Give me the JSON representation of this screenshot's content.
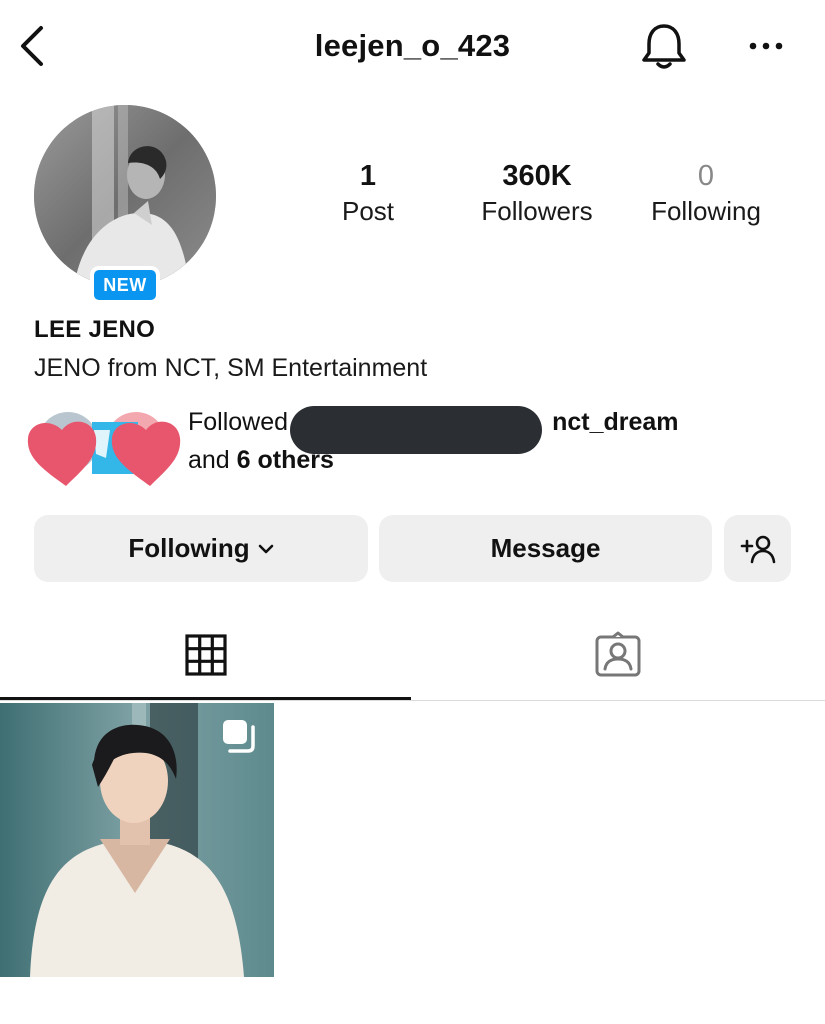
{
  "header": {
    "username": "leejen_o_423",
    "icons": {
      "back": "chevron-left-icon",
      "notifications": "bell-icon",
      "more": "more-horizontal-icon"
    }
  },
  "profile": {
    "avatar_icon": "profile-photo",
    "badge": "NEW",
    "display_name": "LEE JENO",
    "bio": "JENO from NCT, SM Entertainment"
  },
  "stats": {
    "posts": {
      "value": "1",
      "label": "Post"
    },
    "followers": {
      "value": "360K",
      "label": "Followers"
    },
    "following": {
      "value": "0",
      "label": "Following"
    }
  },
  "followed_by": {
    "prefix": "Followed",
    "account": "nct_dream",
    "and_text": "and",
    "others": "6 others"
  },
  "actions": {
    "following_label": "Following",
    "message_label": "Message",
    "add_user_icon": "add-user-icon"
  },
  "tabs": [
    {
      "id": "grid",
      "icon": "grid-icon",
      "active": true
    },
    {
      "id": "tagged",
      "icon": "tagged-user-icon",
      "active": false
    }
  ],
  "posts": [
    {
      "type": "multi-image",
      "icon": "multiple-images-icon"
    }
  ],
  "colors": {
    "badge_blue": "#0a96f0",
    "button_bg": "#efefef",
    "heart_pink": "#e8566d",
    "redaction": "#2b2f33"
  }
}
